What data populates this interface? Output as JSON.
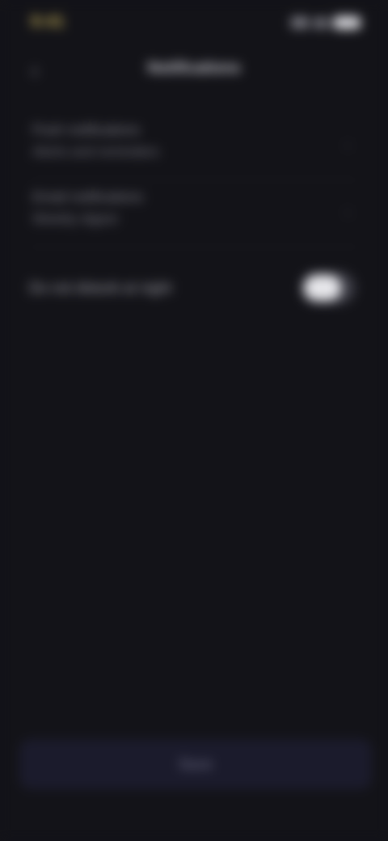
{
  "status_bar": {
    "time": "9:41",
    "signal_icon": "signal-icon",
    "wifi_icon": "wifi-icon",
    "battery_icon": "battery-icon"
  },
  "header": {
    "back_icon": "chevron-left-icon",
    "back_glyph": "‹",
    "title": "Notifications"
  },
  "settings": {
    "items": [
      {
        "title": "Push notifications",
        "subtitle": "Alerts and reminders"
      },
      {
        "title": "Email notifications",
        "subtitle": "Weekly digest"
      }
    ],
    "chevron_glyph": "›",
    "toggle": {
      "label": "Do not disturb at night",
      "state": "on"
    }
  },
  "footer": {
    "button_label": "Save"
  },
  "colors": {
    "background": "#131318",
    "accent_time": "#c9b35a",
    "button_bg": "#1b1b2c"
  }
}
